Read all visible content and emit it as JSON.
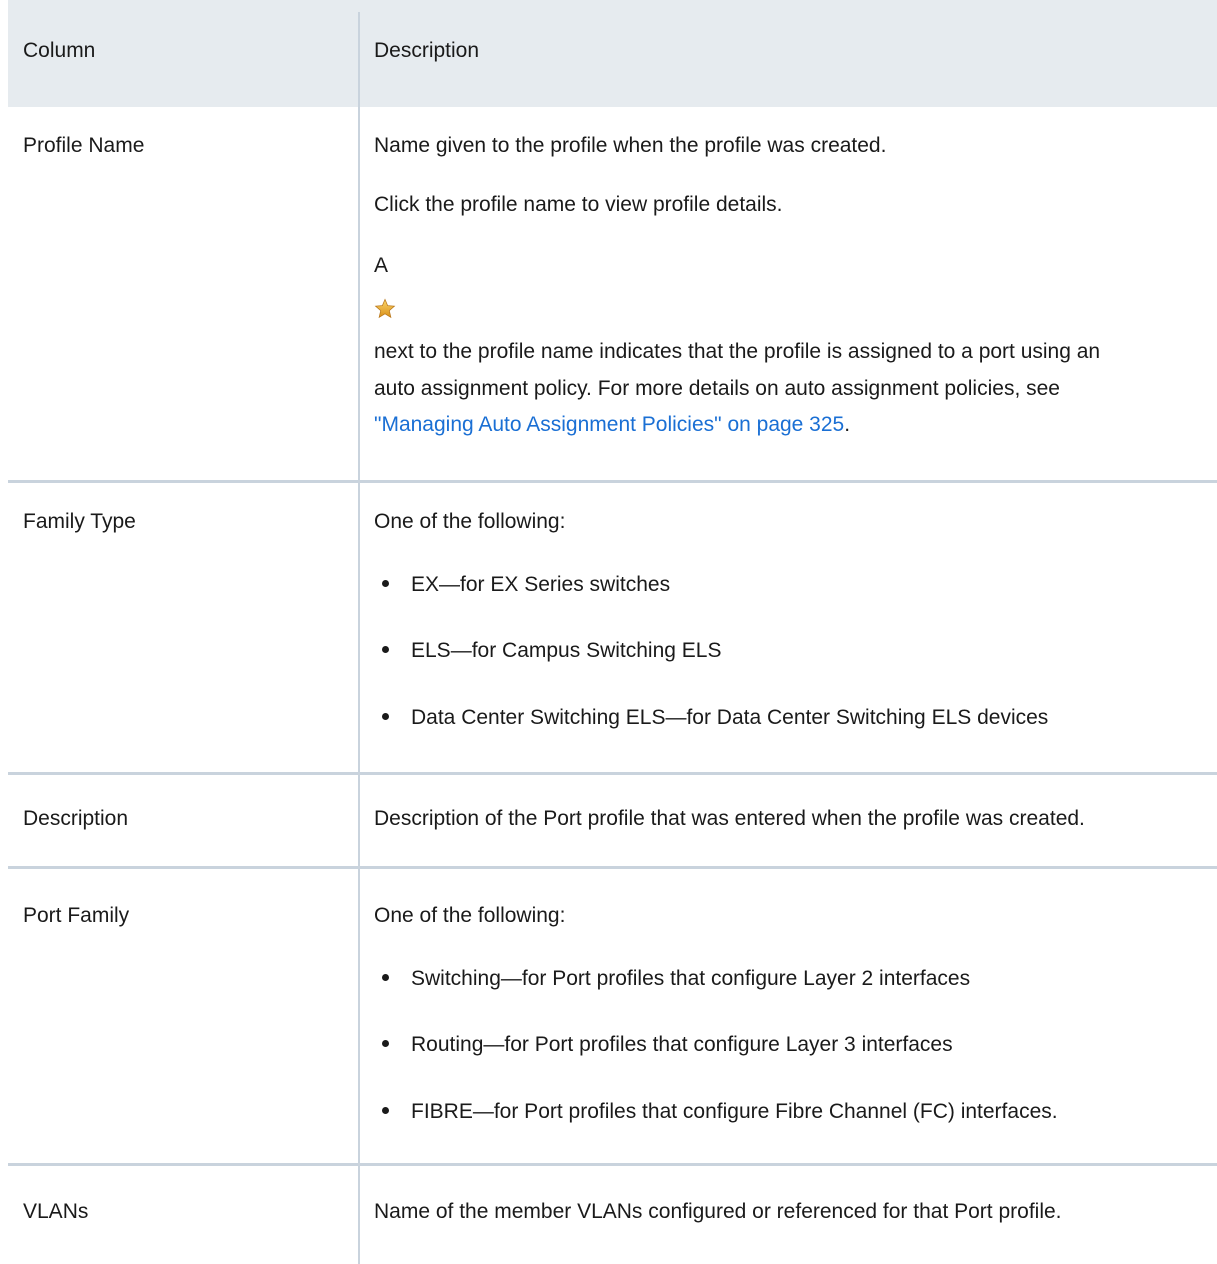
{
  "table": {
    "headers": {
      "column": "Column",
      "description": "Description"
    },
    "rows": [
      {
        "name": "Profile Name",
        "desc_p1": "Name given to the profile when the profile was created.",
        "desc_p2": "Click the profile name to view profile details.",
        "desc_p3_prefix": "A",
        "desc_p3_icon": "star-icon",
        "desc_p3_line1": "next to the profile name indicates that the profile is assigned to a port using an",
        "desc_p3_line2": "auto assignment policy. For more details on auto assignment policies, see",
        "desc_p3_link": "\"Managing Auto Assignment Policies\" on page 325",
        "desc_p3_suffix": "."
      },
      {
        "name": "Family Type",
        "intro": "One of the following:",
        "items": [
          "EX—for EX Series switches",
          "ELS—for Campus Switching ELS",
          "Data Center Switching ELS—for Data Center Switching ELS devices"
        ]
      },
      {
        "name": "Description",
        "desc": "Description of the Port profile that was entered when the profile was created."
      },
      {
        "name": "Port Family",
        "intro": "One of the following:",
        "items": [
          "Switching—for Port profiles that configure Layer 2 interfaces",
          "Routing—for Port profiles that configure Layer 3 interfaces",
          "FIBRE—for Port profiles that configure Fibre Channel (FC) interfaces."
        ]
      },
      {
        "name": "VLANs",
        "desc": "Name of the member VLANs configured or referenced for that Port profile."
      }
    ]
  },
  "colors": {
    "header_bg": "#e6ebef",
    "divider": "#c9d3dd",
    "link": "#1a6fd4",
    "star": "#f0b429"
  }
}
